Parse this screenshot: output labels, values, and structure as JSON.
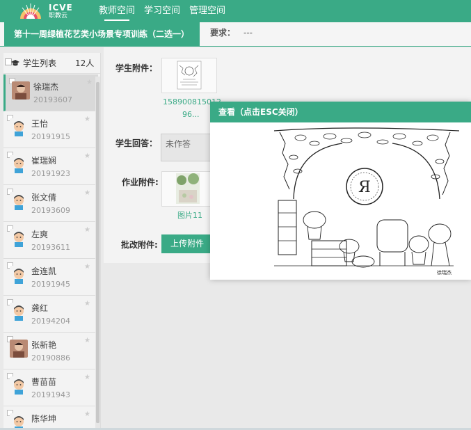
{
  "brand": {
    "logo_text": "ICVE",
    "logo_sub": "职教云"
  },
  "nav": [
    {
      "label": "教师空间",
      "active": true
    },
    {
      "label": "学习空间",
      "active": false
    },
    {
      "label": "管理空间",
      "active": false
    }
  ],
  "assignment": {
    "title": "第十一周绿植花艺类小场景专项训练（二选一）",
    "requirement_label": "要求：",
    "requirement_value": "---"
  },
  "sidebar": {
    "title": "学生列表",
    "count": "12人",
    "students": [
      {
        "name": "徐瑞杰",
        "id": "20193607",
        "avatar": "photo"
      },
      {
        "name": "王怡",
        "id": "20191915",
        "avatar": "cartoon"
      },
      {
        "name": "崔瑞娴",
        "id": "20191923",
        "avatar": "cartoon"
      },
      {
        "name": "张文倩",
        "id": "20193609",
        "avatar": "cartoon"
      },
      {
        "name": "左爽",
        "id": "20193611",
        "avatar": "cartoon"
      },
      {
        "name": "金连凯",
        "id": "20191945",
        "avatar": "cartoon"
      },
      {
        "name": "龚红",
        "id": "20194204",
        "avatar": "cartoon"
      },
      {
        "name": "张新艳",
        "id": "20190886",
        "avatar": "photo"
      },
      {
        "name": "曹苗苗",
        "id": "20191943",
        "avatar": "cartoon"
      },
      {
        "name": "陈华坤",
        "id": "",
        "avatar": "cartoon"
      }
    ]
  },
  "detail": {
    "student_attachment_label": "学生附件：",
    "student_attachment_name": "15890081501296...",
    "student_attachment_line1": "158900815012",
    "student_attachment_line2": "96...",
    "student_answer_label": "学生回答：",
    "student_answer_value": "未作答",
    "homework_attachment_label": "作业附件:",
    "homework_attachment_name": "图片11",
    "review_attachment_label": "批改附件:",
    "upload_label": "上传附件"
  },
  "dialog": {
    "title": "查看（点击ESC关闭）",
    "signature": "徐瑞杰"
  },
  "colors": {
    "primary": "#3aaa86",
    "header_bg": "#3aaa86",
    "page_bg": "#e9e9e9"
  }
}
